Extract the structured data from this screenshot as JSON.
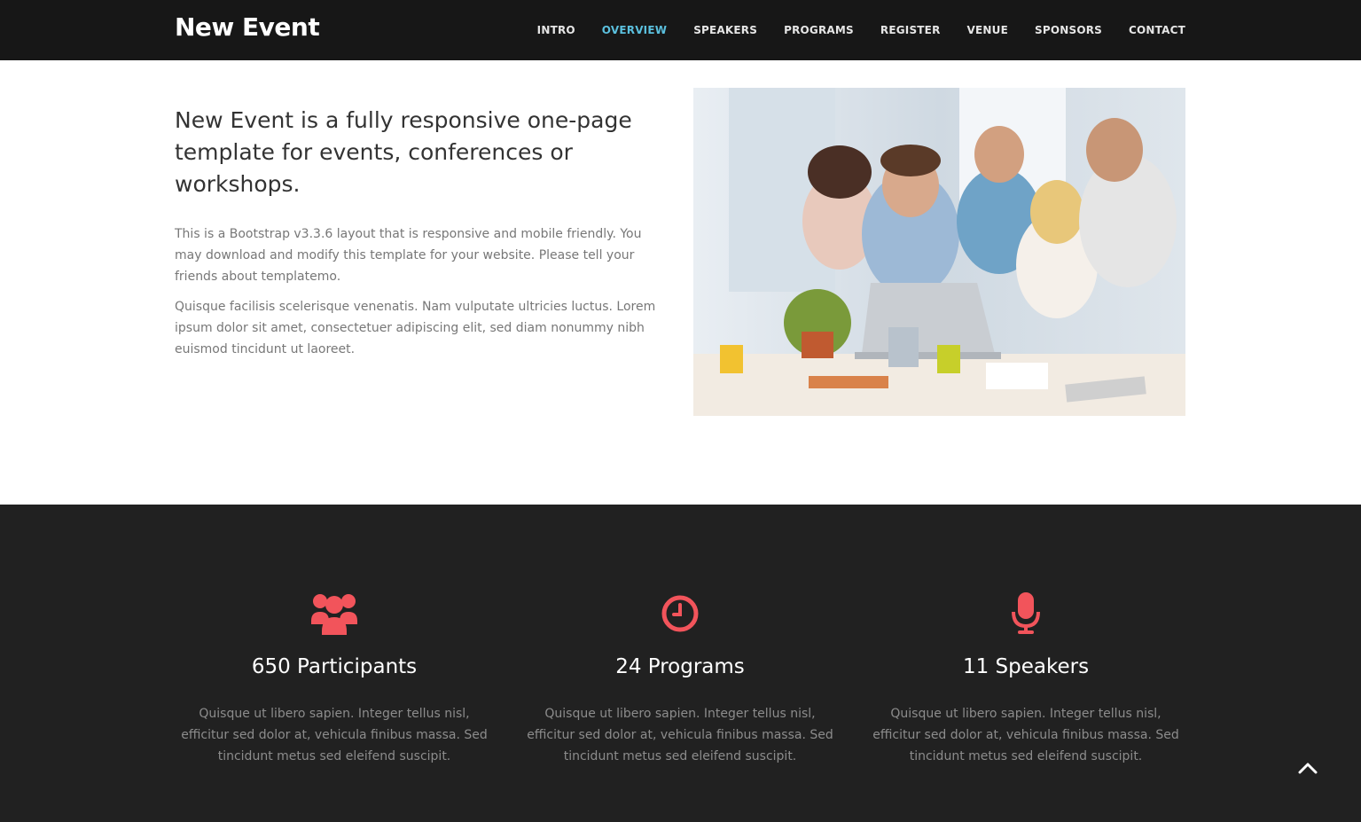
{
  "header": {
    "brand": "New Event",
    "nav": [
      {
        "label": "INTRO",
        "active": false
      },
      {
        "label": "OVERVIEW",
        "active": true
      },
      {
        "label": "SPEAKERS",
        "active": false
      },
      {
        "label": "PROGRAMS",
        "active": false
      },
      {
        "label": "REGISTER",
        "active": false
      },
      {
        "label": "VENUE",
        "active": false
      },
      {
        "label": "SPONSORS",
        "active": false
      },
      {
        "label": "CONTACT",
        "active": false
      }
    ]
  },
  "overview": {
    "heading": "New Event is a fully responsive one-page template for events, conferences or workshops.",
    "paragraph_1": "This is a Bootstrap v3.3.6 layout that is responsive and mobile friendly. You may download and modify this template for your website. Please tell your friends about templatemo.",
    "paragraph_2": "Quisque facilisis scelerisque venenatis. Nam vulputate ultricies luctus. Lorem ipsum dolor sit amet, consectetuer adipiscing elit, sed diam nonummy nibh euismod tincidunt ut laoreet.",
    "image_icon": "team-meeting-photo"
  },
  "stats": [
    {
      "icon": "users-icon",
      "title": "650 Participants",
      "text": "Quisque ut libero sapien. Integer tellus nisl, efficitur sed dolor at, vehicula finibus massa. Sed tincidunt metus sed eleifend suscipit."
    },
    {
      "icon": "clock-icon",
      "title": "24 Programs",
      "text": "Quisque ut libero sapien. Integer tellus nisl, efficitur sed dolor at, vehicula finibus massa. Sed tincidunt metus sed eleifend suscipit."
    },
    {
      "icon": "microphone-icon",
      "title": "11 Speakers",
      "text": "Quisque ut libero sapien. Integer tellus nisl, efficitur sed dolor at, vehicula finibus massa. Sed tincidunt metus sed eleifend suscipit."
    }
  ],
  "back_to_top_icon": "chevron-up-icon",
  "colors": {
    "nav_bg": "#171717",
    "nav_active": "#5bc0de",
    "accent": "#f2545b",
    "stats_bg": "#212121"
  }
}
